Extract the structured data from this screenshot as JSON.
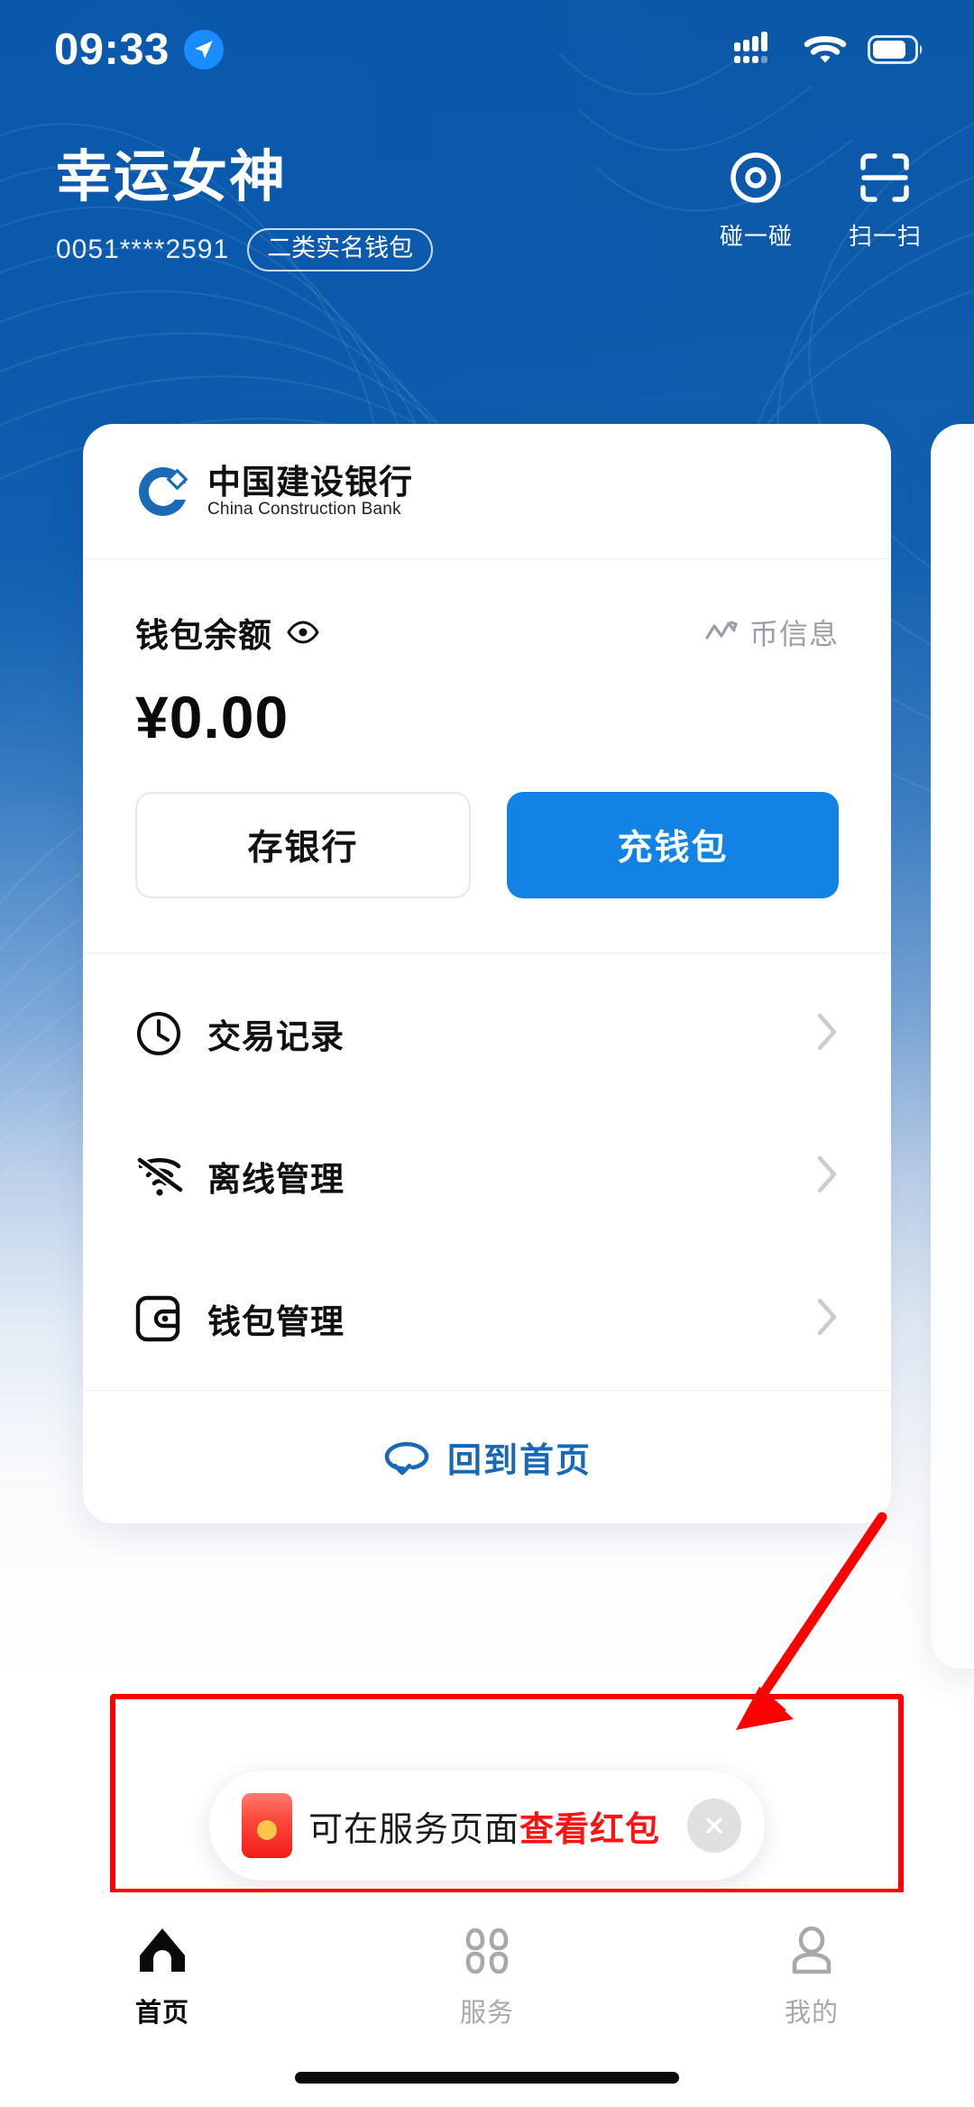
{
  "status_bar": {
    "time": "09:33",
    "location_icon": "location-arrow-icon",
    "signal_icon": "cellular-signal-icon",
    "wifi_icon": "wifi-icon",
    "battery_icon": "battery-icon",
    "battery_level": 75
  },
  "header": {
    "title": "幸运女神",
    "account_number": "0051****2591",
    "account_badge": "二类实名钱包",
    "actions": [
      {
        "label": "碰一碰",
        "icon": "nfc-tap-icon"
      },
      {
        "label": "扫一扫",
        "icon": "scan-qr-icon"
      }
    ]
  },
  "card": {
    "bank_name_cn": "中国建设银行",
    "bank_name_en": "China Construction Bank",
    "bank_logo_icon": "ccb-logo-icon",
    "balance_label": "钱包余额",
    "balance_eye_icon": "eye-icon",
    "coin_info_label": "币信息",
    "coin_info_icon": "trend-chart-icon",
    "balance_amount": "¥0.00",
    "buttons": {
      "deposit": "存银行",
      "topup": "充钱包"
    },
    "menu_items": [
      {
        "label": "交易记录",
        "icon": "clock-icon"
      },
      {
        "label": "离线管理",
        "icon": "wifi-offline-icon"
      },
      {
        "label": "钱包管理",
        "icon": "wallet-icon"
      }
    ],
    "footer_link": "回到首页",
    "footer_icon": "return-home-icon"
  },
  "toast": {
    "envelope_icon": "red-envelope-icon",
    "text_normal": "可在服务页面",
    "text_highlight": "查看红包",
    "close_icon": "close-icon"
  },
  "tabbar": [
    {
      "label": "首页",
      "icon": "home-icon",
      "active": true
    },
    {
      "label": "服务",
      "icon": "grid-services-icon",
      "active": false
    },
    {
      "label": "我的",
      "icon": "person-icon",
      "active": false
    }
  ],
  "colors": {
    "brand_blue": "#0c57a8",
    "accent_blue": "#1283e4",
    "link_blue": "#1769b8",
    "annotation_red": "#fe0000",
    "highlight_red": "#fb1414"
  }
}
